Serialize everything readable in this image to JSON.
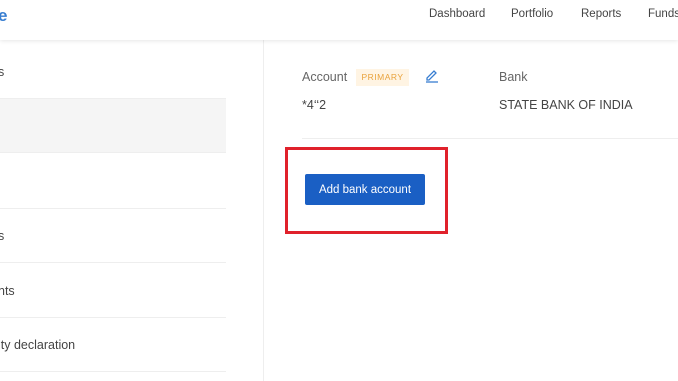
{
  "header": {
    "logo_text": "e",
    "nav": [
      "Dashboard",
      "Portfolio",
      "Reports",
      "Funds"
    ]
  },
  "sidebar": {
    "items": [
      {
        "label": "s"
      },
      {
        "label": ""
      },
      {
        "label": ""
      },
      {
        "label": "s"
      },
      {
        "label": "nts"
      },
      {
        "label": "ity declaration"
      }
    ]
  },
  "account": {
    "account_label": "Account",
    "primary_badge": "PRIMARY",
    "account_number": "*4‘‘2",
    "bank_label": "Bank",
    "bank_name": "STATE BANK OF INDIA"
  },
  "actions": {
    "add_bank_account": "Add bank account"
  },
  "colors": {
    "brand": "#387ed1",
    "button": "#1a5fc4",
    "highlight": "#e0212b",
    "badge_bg": "#fff4e3",
    "badge_text": "#e9a23b"
  }
}
